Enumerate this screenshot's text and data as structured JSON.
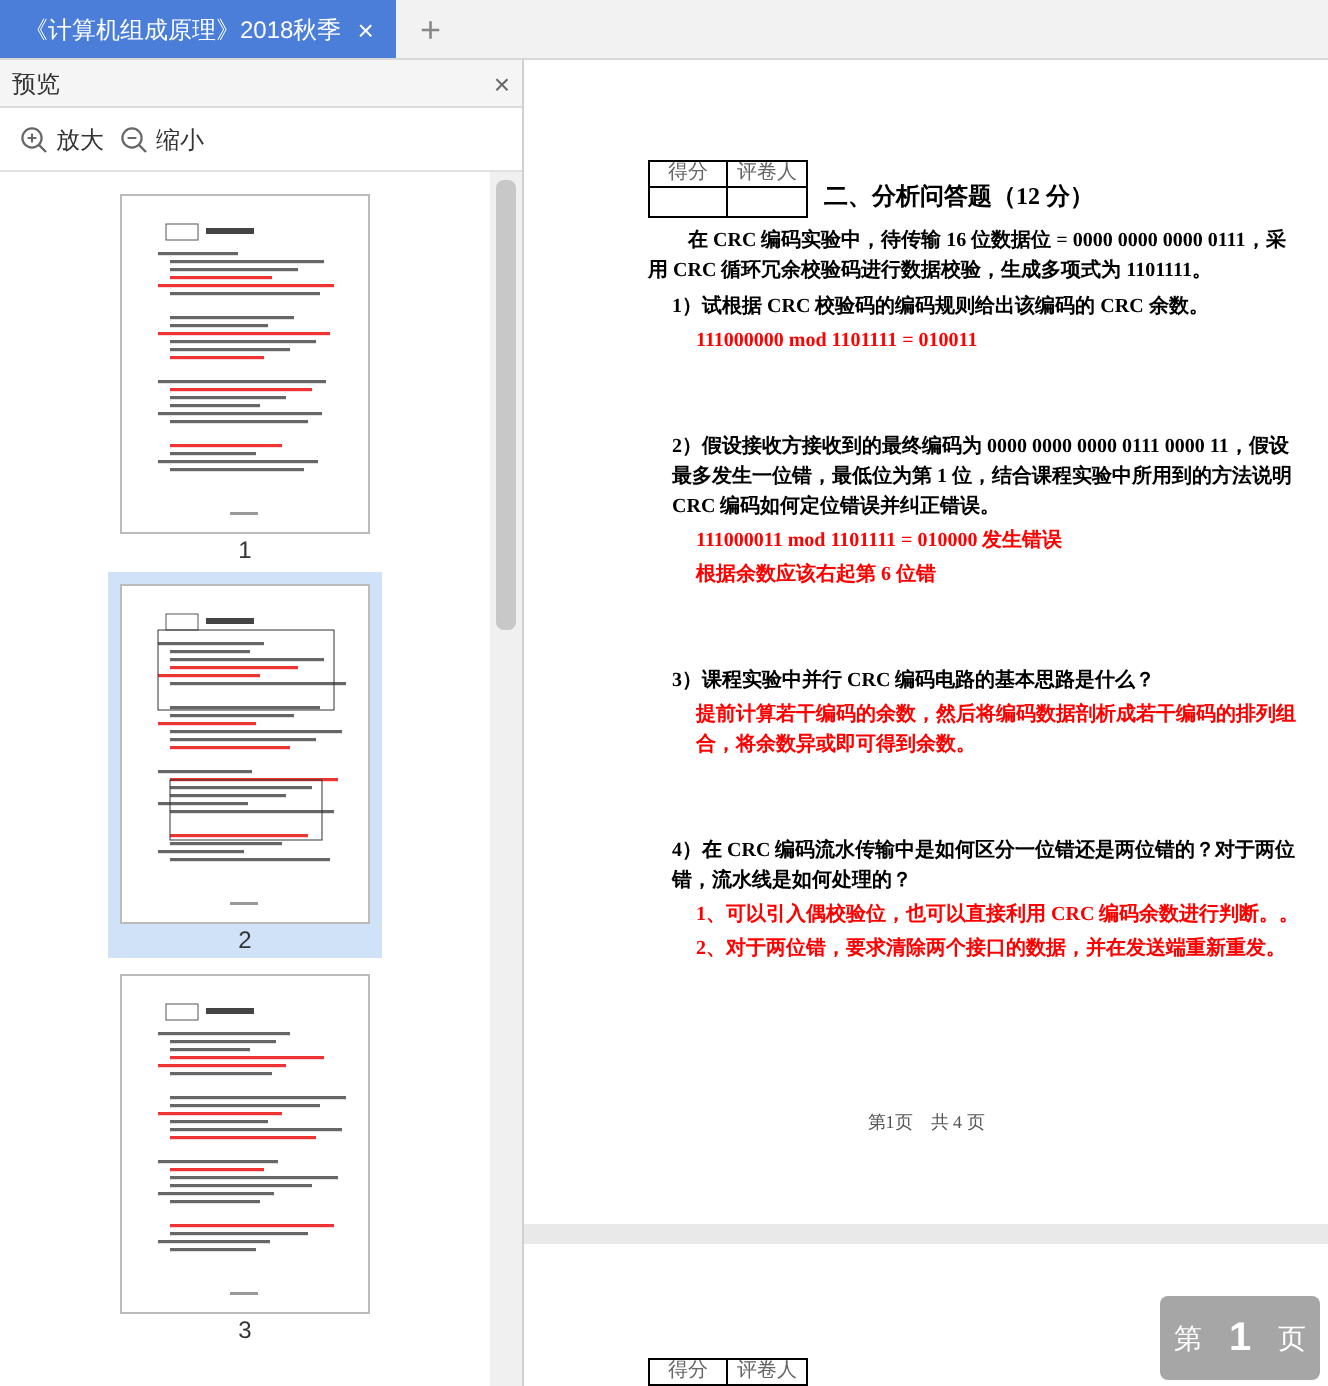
{
  "tabs": [
    {
      "title": "《计算机组成原理》2018秋季",
      "selected": true,
      "close": "×"
    }
  ],
  "new_tab": "+",
  "preview_panel": {
    "title": "预览",
    "close": "×",
    "zoom_in": "放大",
    "zoom_out": "缩小",
    "thumbnails": [
      {
        "page": "1",
        "selected": false
      },
      {
        "page": "2",
        "selected": true
      },
      {
        "page": "3",
        "selected": false
      }
    ]
  },
  "document": {
    "pages": [
      {
        "score_table": [
          "得分",
          "评卷人"
        ],
        "heading": "二、分析问答题（12 分）",
        "paragraphs": [
          {
            "kind": "body",
            "text": "在 CRC 编码实验中，待传输 16 位数据位 = 0000 0000 0000 0111，采用 CRC 循环冗余校验码进行数据校验，生成多项式为 1101111。"
          },
          {
            "kind": "question",
            "text": "1）试根据 CRC 校验码的编码规则给出该编码的 CRC 余数。"
          },
          {
            "kind": "answer",
            "text": "111000000 mod 1101111 = 010011"
          },
          {
            "kind": "question",
            "text": "2）假设接收方接收到的最终编码为 0000 0000 0000 0111 0000 11，假设最多发生一位错，最低位为第 1 位，结合课程实验中所用到的方法说明 CRC 编码如何定位错误并纠正错误。"
          },
          {
            "kind": "answer",
            "text": "111000011  mod 1101111 = 010000   发生错误"
          },
          {
            "kind": "answer",
            "text": "根据余数应该右起第 6 位错"
          },
          {
            "kind": "question",
            "text": "3）课程实验中并行 CRC 编码电路的基本思路是什么？"
          },
          {
            "kind": "answer",
            "text": "提前计算若干编码的余数，然后将编码数据剖析成若干编码的排列组合，将余数异或即可得到余数。"
          },
          {
            "kind": "question",
            "text": "4）在 CRC 编码流水传输中是如何区分一位错还是两位错的？对于两位错，流水线是如何处理的？"
          },
          {
            "kind": "answer",
            "text": "1、可以引入偶校验位，也可以直接利用 CRC 编码余数进行判断。。"
          },
          {
            "kind": "answer",
            "text": "2、对于两位错，要求清除两个接口的数据，并在发送端重新重发。"
          }
        ],
        "footer": "第1页　共 4 页"
      },
      {
        "score_table": [
          "得分",
          "评卷人"
        ]
      }
    ]
  },
  "page_indicator": {
    "prefix": "第",
    "number": "1",
    "suffix": "页"
  }
}
